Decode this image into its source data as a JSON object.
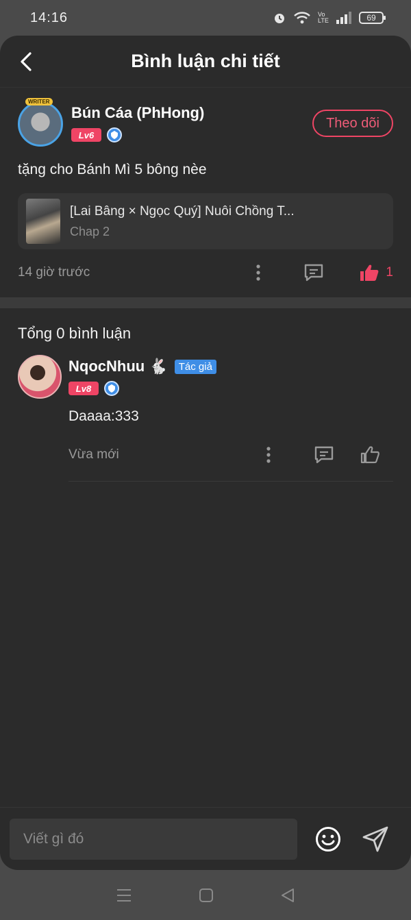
{
  "status_bar": {
    "time": "14:16",
    "battery": "69",
    "network_label": "Vo LTE"
  },
  "header": {
    "title": "Bình luận chi tiết"
  },
  "main_comment": {
    "author_name": "Bún Cáa (PhHong)",
    "avatar_badge": "WRITER",
    "level": "Lv6",
    "follow_label": "Theo dõi",
    "text": "tặng cho Bánh Mì 5 bông nèe",
    "chapter": {
      "title": "[Lai Bâng × Ngọc Quý] Nuôi Chồng T...",
      "subtitle": "Chap 2"
    },
    "timestamp": "14 giờ trước",
    "like_count": "1"
  },
  "replies": {
    "total_label": "Tổng 0 bình luận",
    "items": [
      {
        "author_name": "NqocNhuu",
        "name_emoji": "🐇",
        "tag": "Tác giả",
        "level": "Lv8",
        "text": "Daaaa:333",
        "timestamp": "Vừa mới"
      }
    ]
  },
  "composer": {
    "placeholder": "Viết gì đó"
  },
  "colors": {
    "accent": "#ef4565",
    "background": "#2b2b2b",
    "tag_blue": "#3f8ee6"
  }
}
